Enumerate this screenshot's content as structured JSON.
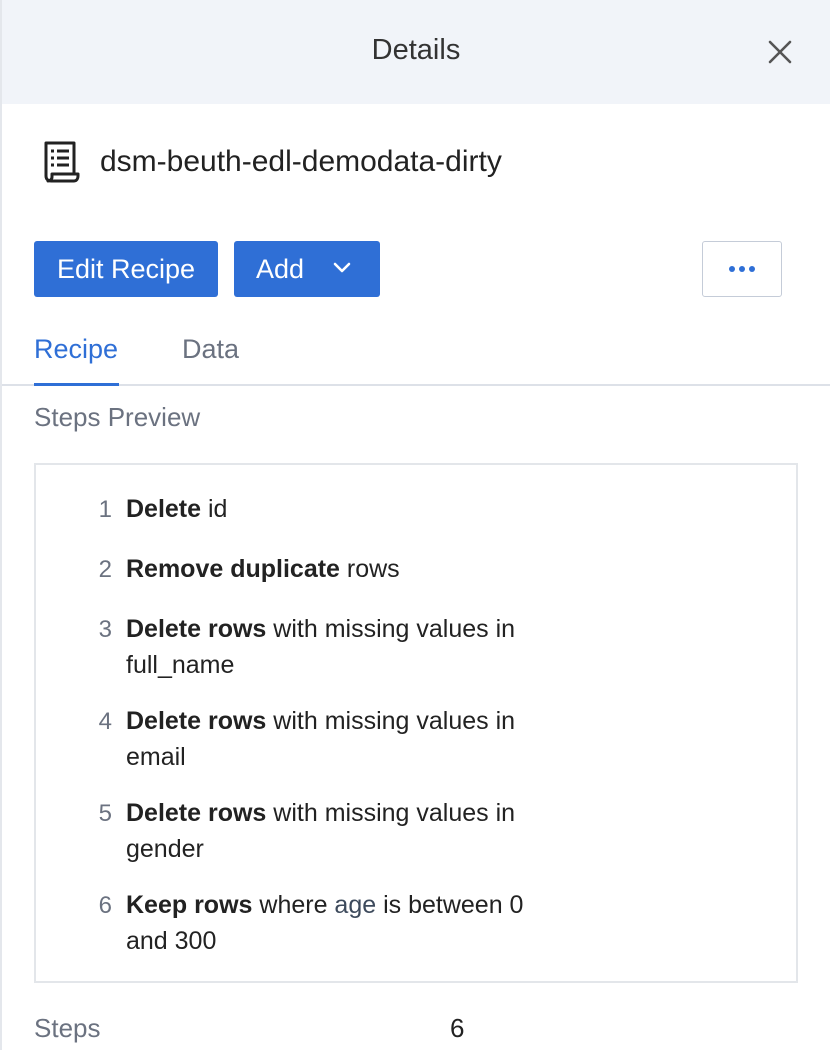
{
  "header": {
    "title": "Details"
  },
  "recipe": {
    "name": "dsm-beuth-edl-demodata-dirty"
  },
  "actions": {
    "edit_label": "Edit Recipe",
    "add_label": "Add",
    "more_label": "•••"
  },
  "tabs": [
    {
      "label": "Recipe",
      "active": true
    },
    {
      "label": "Data",
      "active": false
    }
  ],
  "steps_preview": {
    "label": "Steps Preview",
    "steps": [
      {
        "num": "1",
        "action": "Delete",
        "line1": " id",
        "line2": ""
      },
      {
        "num": "2",
        "action": "Remove duplicate",
        "line1": " rows",
        "line2": ""
      },
      {
        "num": "3",
        "action": "Delete rows",
        "line1": " with missing values in",
        "line2": "full_name"
      },
      {
        "num": "4",
        "action": "Delete rows",
        "line1": " with missing values in",
        "line2": "email"
      },
      {
        "num": "5",
        "action": "Delete rows",
        "line1": " with missing values in",
        "line2": "gender"
      },
      {
        "num": "6",
        "action": "Keep rows",
        "line1a": " where ",
        "column": "age",
        "line1b": " is between 0",
        "line2": "and 300"
      }
    ]
  },
  "summary": {
    "steps_label": "Steps",
    "steps_value": "6"
  },
  "colors": {
    "accent": "#2f6fd6",
    "header_bg": "#f1f4f9"
  }
}
